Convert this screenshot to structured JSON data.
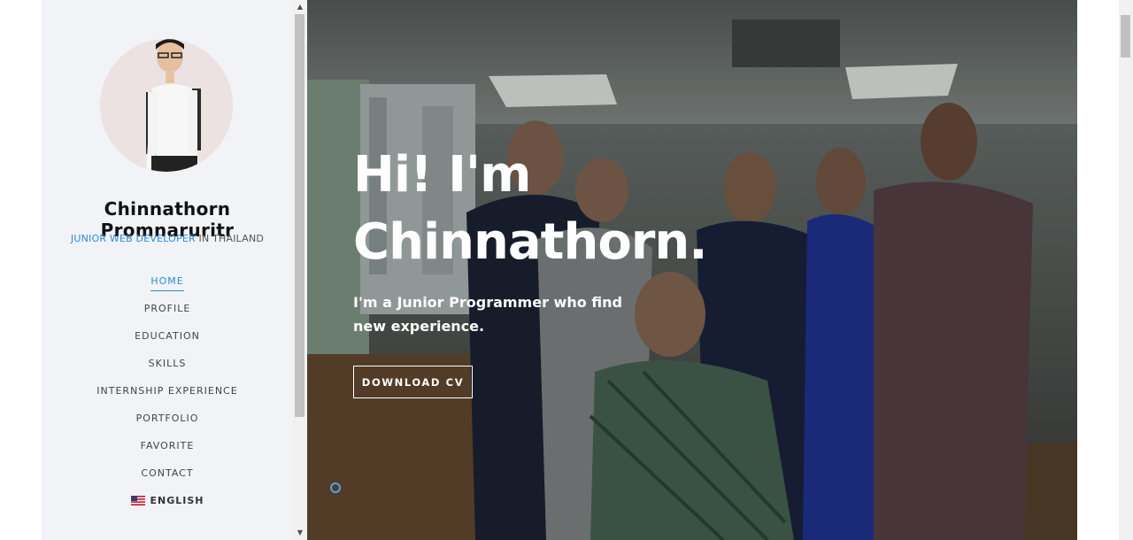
{
  "sidebar": {
    "name": "Chinnathorn Promnaruritr",
    "subtitle_accent": "JUNIOR WEB DEVELOPER",
    "subtitle_rest": " IN THAILAND",
    "nav": [
      {
        "label": "HOME",
        "active": true
      },
      {
        "label": "PROFILE"
      },
      {
        "label": "EDUCATION"
      },
      {
        "label": "SKILLS"
      },
      {
        "label": "INTERNSHIP EXPERIENCE"
      },
      {
        "label": "PORTFOLIO"
      },
      {
        "label": "FAVORITE"
      },
      {
        "label": "CONTACT"
      }
    ],
    "language": "ENGLISH"
  },
  "hero": {
    "heading_line1": "Hi! I'm",
    "heading_line2": "Chinnathorn.",
    "tagline": "I'm a Junior Programmer who find new experience.",
    "button": "DOWNLOAD CV"
  },
  "colors": {
    "accent": "#2f89d6",
    "sidebar_bg": "#f1f3f7",
    "hero_text": "#ffffff"
  },
  "icons": {
    "language_flag": "us-flag-icon",
    "scroll_up": "scroll-up-arrow-icon",
    "scroll_down": "scroll-down-arrow-icon"
  }
}
